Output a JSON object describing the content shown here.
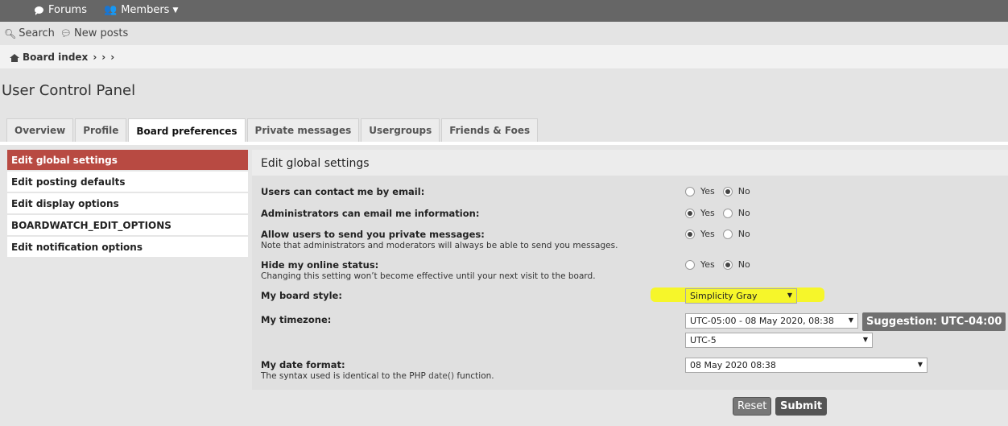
{
  "topbar": {
    "menu_icon": "hamburger-icon",
    "forums_label": "Forums",
    "members_label": "Members"
  },
  "subbar": {
    "search_label": "Search",
    "new_posts_label": "New posts"
  },
  "breadcrumb": {
    "home_label": "Board index",
    "sep1": "›",
    "sep2": "›",
    "sep3": "›"
  },
  "page_title": "User Control Panel",
  "tabs": [
    {
      "label": "Overview"
    },
    {
      "label": "Profile"
    },
    {
      "label": "Board preferences",
      "active": true
    },
    {
      "label": "Private messages"
    },
    {
      "label": "Usergroups"
    },
    {
      "label": "Friends & Foes"
    }
  ],
  "sidenav": [
    {
      "label": "Edit global settings",
      "active": true
    },
    {
      "label": "Edit posting defaults"
    },
    {
      "label": "Edit display options"
    },
    {
      "label": "BOARDWATCH_EDIT_OPTIONS"
    },
    {
      "label": "Edit notification options"
    }
  ],
  "content": {
    "title": "Edit global settings",
    "yes_label": "Yes",
    "no_label": "No",
    "fields": {
      "contact_email": {
        "label": "Users can contact me by email:",
        "value": "No"
      },
      "admin_email": {
        "label": "Administrators can email me information:",
        "value": "Yes"
      },
      "allow_pm": {
        "label": "Allow users to send you private messages:",
        "desc": "Note that administrators and moderators will always be able to send you messages.",
        "value": "Yes"
      },
      "hide_online": {
        "label": "Hide my online status:",
        "desc": "Changing this setting won’t become effective until your next visit to the board.",
        "value": "No"
      },
      "board_style": {
        "label": "My board style:",
        "value": "Simplicity Gray"
      },
      "timezone": {
        "label": "My timezone:",
        "value": "UTC-05:00 - 08 May 2020, 08:38",
        "zone": "UTC-5",
        "suggestion": "Suggestion: UTC-04:00"
      },
      "date_format": {
        "label": "My date format:",
        "desc_prefix": "The syntax used is identical to the PHP ",
        "desc_link": "date()",
        "desc_suffix": " function.",
        "value": "08 May 2020 08:38"
      }
    }
  },
  "buttons": {
    "reset": "Reset",
    "submit": "Submit"
  },
  "colors": {
    "active_tab_nav": "#b84a42",
    "highlight": "#f6f62a",
    "topbar": "#666666"
  }
}
